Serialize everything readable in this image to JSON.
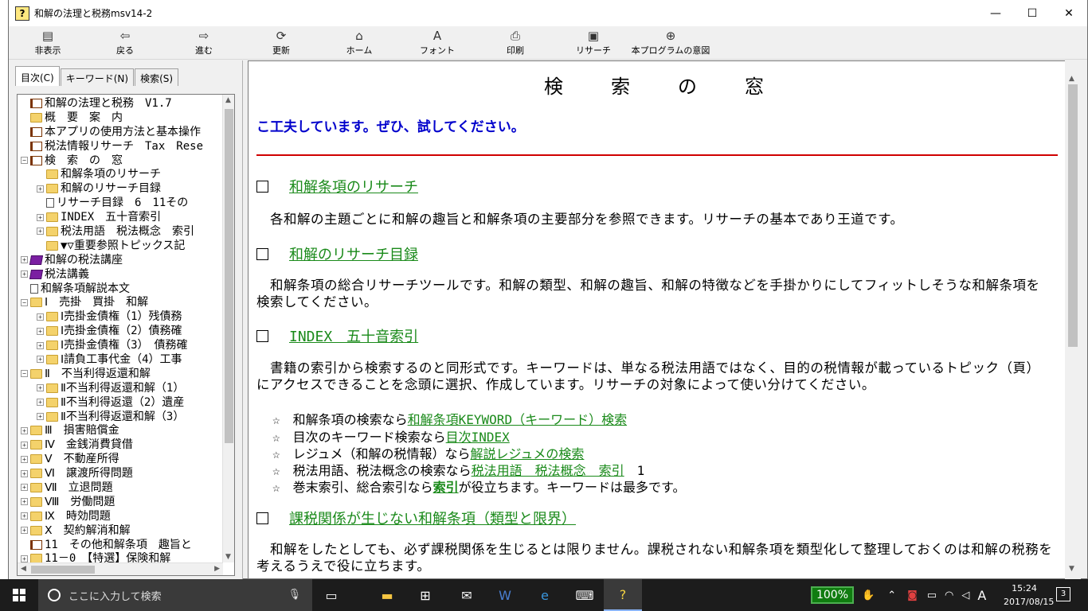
{
  "window": {
    "title": "和解の法理と税務msv14-2",
    "icon": "help-book-icon",
    "controls": [
      "—",
      "☐",
      "✕"
    ]
  },
  "toolbar": {
    "hide": "非表示",
    "back": "戻る",
    "forward": "進む",
    "refresh": "更新",
    "home": "ホーム",
    "font": "フォント",
    "print": "印刷",
    "research": "リサーチ",
    "purpose": "本プログラムの意図"
  },
  "leftpane": {
    "tabs": [
      "目次(C)",
      "キーワード(N)",
      "検索(S)"
    ],
    "tree": [
      {
        "indent": 0,
        "exp": "",
        "icon": "openbook",
        "label": "和解の法理と税務　V1.7"
      },
      {
        "indent": 0,
        "exp": "",
        "icon": "folder",
        "label": "概　要　案　内"
      },
      {
        "indent": 0,
        "exp": "",
        "icon": "openbook",
        "label": "本アプリの使用方法と基本操作"
      },
      {
        "indent": 0,
        "exp": "",
        "icon": "openbook",
        "label": "税法情報リサーチ　Tax　Rese"
      },
      {
        "indent": 0,
        "exp": "−",
        "icon": "openbook",
        "label": "検　索　の　窓"
      },
      {
        "indent": 1,
        "exp": "",
        "icon": "folder",
        "label": "和解条項のリサーチ"
      },
      {
        "indent": 1,
        "exp": "+",
        "icon": "folder",
        "label": "和解のリサーチ目録"
      },
      {
        "indent": 1,
        "exp": "",
        "icon": "page",
        "label": "リサーチ目録　6　11その"
      },
      {
        "indent": 1,
        "exp": "+",
        "icon": "folder",
        "label": "INDEX　五十音索引"
      },
      {
        "indent": 1,
        "exp": "+",
        "icon": "folder",
        "label": "税法用語　税法概念　索引"
      },
      {
        "indent": 1,
        "exp": "",
        "icon": "folder",
        "label": "▼▽重要参照トピックス記"
      },
      {
        "indent": 0,
        "exp": "+",
        "icon": "book",
        "label": "和解の税法講座"
      },
      {
        "indent": 0,
        "exp": "+",
        "icon": "book",
        "label": "税法講義"
      },
      {
        "indent": 0,
        "exp": "",
        "icon": "page",
        "label": "和解条項解説本文"
      },
      {
        "indent": 0,
        "exp": "−",
        "icon": "folder",
        "label": "Ⅰ　売掛　買掛　和解"
      },
      {
        "indent": 1,
        "exp": "+",
        "icon": "folder",
        "label": "Ⅰ売掛金債権（1）残債務"
      },
      {
        "indent": 1,
        "exp": "+",
        "icon": "folder",
        "label": "Ⅰ売掛金債権（2）債務確"
      },
      {
        "indent": 1,
        "exp": "+",
        "icon": "folder",
        "label": "Ⅰ売掛金債権（3）　債務確"
      },
      {
        "indent": 1,
        "exp": "+",
        "icon": "folder",
        "label": "Ⅰ請負工事代金（4）工事"
      },
      {
        "indent": 0,
        "exp": "−",
        "icon": "folder",
        "label": "Ⅱ　不当利得返還和解"
      },
      {
        "indent": 1,
        "exp": "+",
        "icon": "folder",
        "label": "Ⅱ不当利得返還和解（1）"
      },
      {
        "indent": 1,
        "exp": "+",
        "icon": "folder",
        "label": "Ⅱ不当利得返還（2）遺産"
      },
      {
        "indent": 1,
        "exp": "+",
        "icon": "folder",
        "label": "Ⅱ不当利得返還和解（3）"
      },
      {
        "indent": 0,
        "exp": "+",
        "icon": "folder",
        "label": "Ⅲ　損害賠償金"
      },
      {
        "indent": 0,
        "exp": "+",
        "icon": "folder",
        "label": "Ⅳ　金銭消費貸借"
      },
      {
        "indent": 0,
        "exp": "+",
        "icon": "folder",
        "label": "Ⅴ　不動産所得"
      },
      {
        "indent": 0,
        "exp": "+",
        "icon": "folder",
        "label": "Ⅵ　譲渡所得問題"
      },
      {
        "indent": 0,
        "exp": "+",
        "icon": "folder",
        "label": "Ⅶ　立退問題"
      },
      {
        "indent": 0,
        "exp": "+",
        "icon": "folder",
        "label": "Ⅷ　労働問題"
      },
      {
        "indent": 0,
        "exp": "+",
        "icon": "folder",
        "label": "Ⅸ　時効問題"
      },
      {
        "indent": 0,
        "exp": "+",
        "icon": "folder",
        "label": "Ⅹ　契約解消和解"
      },
      {
        "indent": 0,
        "exp": "",
        "icon": "openbook",
        "label": "11　その他和解条項　趣旨と"
      },
      {
        "indent": 0,
        "exp": "+",
        "icon": "folder",
        "label": "11－0　【特選】保険和解"
      }
    ]
  },
  "content": {
    "heading": "検　索　の　窓",
    "intro": "こ工夫しています。ぜひ、試してください。",
    "sections": [
      {
        "title": "和解条項のリサーチ",
        "desc": "　各和解の主題ごとに和解の趣旨と和解条項の主要部分を参照できます。リサーチの基本であり王道です。"
      },
      {
        "title": "和解のリサーチ目録",
        "desc": "　和解条項の総合リサーチツールです。和解の類型、和解の趣旨、和解の特徴などを手掛かりにしてフィットしそうな和解条項を検索してください。"
      },
      {
        "title": "INDEX　五十音索引",
        "desc": "　書籍の索引から検索するのと同形式です。キーワードは、単なる税法用語ではなく、目的の税情報が載っているトピック（頁）にアクセスできることを念頭に選択、作成しています。リサーチの対象によって使い分けてください。"
      },
      {
        "title": "課税関係が生じない和解条項（類型と限界）",
        "desc": "　和解をしたとしても、必ず課税関係を生じるとは限りません。課税されない和解条項を類型化して整理しておくのは和解の税務を考えるうえで役に立ちます。"
      }
    ],
    "bullets": [
      {
        "pre": "☆　和解条項の検索なら",
        "link": "和解条項KEYWORD（キーワード）検索",
        "post": ""
      },
      {
        "pre": "☆　目次のキーワード検索なら",
        "link": "目次INDEX",
        "post": ""
      },
      {
        "pre": "☆　レジュメ（和解の税情報）なら",
        "link": "解説レジュメの検索",
        "post": ""
      },
      {
        "pre": "☆　税法用語、税法概念の検索なら",
        "link": "税法用語　税法概念　索引",
        "post": "　1"
      },
      {
        "pre": "☆　巻末索引、総合索引なら",
        "link": "索引",
        "post": "が役立ちます。キーワードは最多です。"
      }
    ]
  },
  "taskbar": {
    "search_placeholder": "ここに入力して検索",
    "zoom": "100%",
    "time": "15:24",
    "date": "2017/08/15",
    "ime": "A",
    "notifications": "3"
  }
}
